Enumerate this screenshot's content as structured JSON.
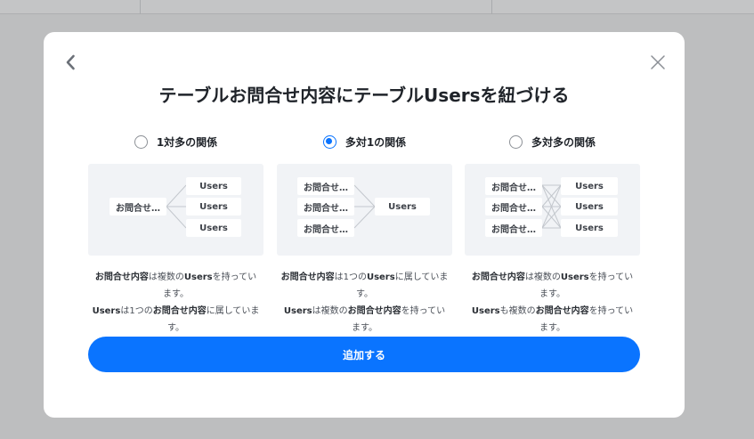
{
  "modal": {
    "title": "テーブルお問合せ内容にテーブルUsersを紐づける",
    "submit_label": "追加する"
  },
  "options": [
    {
      "label": "1対多の関係",
      "selected": false,
      "left_boxes": [
        "お問合せ…"
      ],
      "right_boxes": [
        "Users",
        "Users",
        "Users"
      ],
      "desc": [
        [
          {
            "t": "お問合せ内容",
            "b": true
          },
          {
            "t": "は複数の",
            "b": false
          },
          {
            "t": "Users",
            "b": true
          },
          {
            "t": "を持ってい",
            "b": false
          }
        ],
        [
          {
            "t": "ます。",
            "b": false
          }
        ],
        [
          {
            "t": "Users",
            "b": true
          },
          {
            "t": "は1つの",
            "b": false
          },
          {
            "t": "お問合せ内容",
            "b": true
          },
          {
            "t": "に属していま",
            "b": false
          }
        ],
        [
          {
            "t": "す。",
            "b": false
          }
        ]
      ]
    },
    {
      "label": "多対1の関係",
      "selected": true,
      "left_boxes": [
        "お問合せ…",
        "お問合せ…",
        "お問合せ…"
      ],
      "right_boxes": [
        "Users"
      ],
      "desc": [
        [
          {
            "t": "お問合せ内容",
            "b": true
          },
          {
            "t": "は1つの",
            "b": false
          },
          {
            "t": "Users",
            "b": true
          },
          {
            "t": "に属していま",
            "b": false
          }
        ],
        [
          {
            "t": "す。",
            "b": false
          }
        ],
        [
          {
            "t": "Users",
            "b": true
          },
          {
            "t": "は複数の",
            "b": false
          },
          {
            "t": "お問合せ内容",
            "b": true
          },
          {
            "t": "を持ってい",
            "b": false
          }
        ],
        [
          {
            "t": "ます。",
            "b": false
          }
        ]
      ]
    },
    {
      "label": "多対多の関係",
      "selected": false,
      "left_boxes": [
        "お問合せ…",
        "お問合せ…",
        "お問合せ…"
      ],
      "right_boxes": [
        "Users",
        "Users",
        "Users"
      ],
      "desc": [
        [
          {
            "t": "お問合せ内容",
            "b": true
          },
          {
            "t": "は複数の",
            "b": false
          },
          {
            "t": "Users",
            "b": true
          },
          {
            "t": "を持ってい",
            "b": false
          }
        ],
        [
          {
            "t": "ます。",
            "b": false
          }
        ],
        [
          {
            "t": "Users",
            "b": true
          },
          {
            "t": "も複数の",
            "b": false
          },
          {
            "t": "お問合せ内容",
            "b": true
          },
          {
            "t": "を持ってい",
            "b": false
          }
        ],
        [
          {
            "t": "ます。",
            "b": false
          }
        ]
      ]
    }
  ],
  "icons": {
    "back": "chevron-left-icon",
    "close": "close-icon"
  },
  "colors": {
    "accent": "#0a74ff",
    "diagram_bg": "#f1f3f6",
    "overlay": "#bdbebf"
  }
}
